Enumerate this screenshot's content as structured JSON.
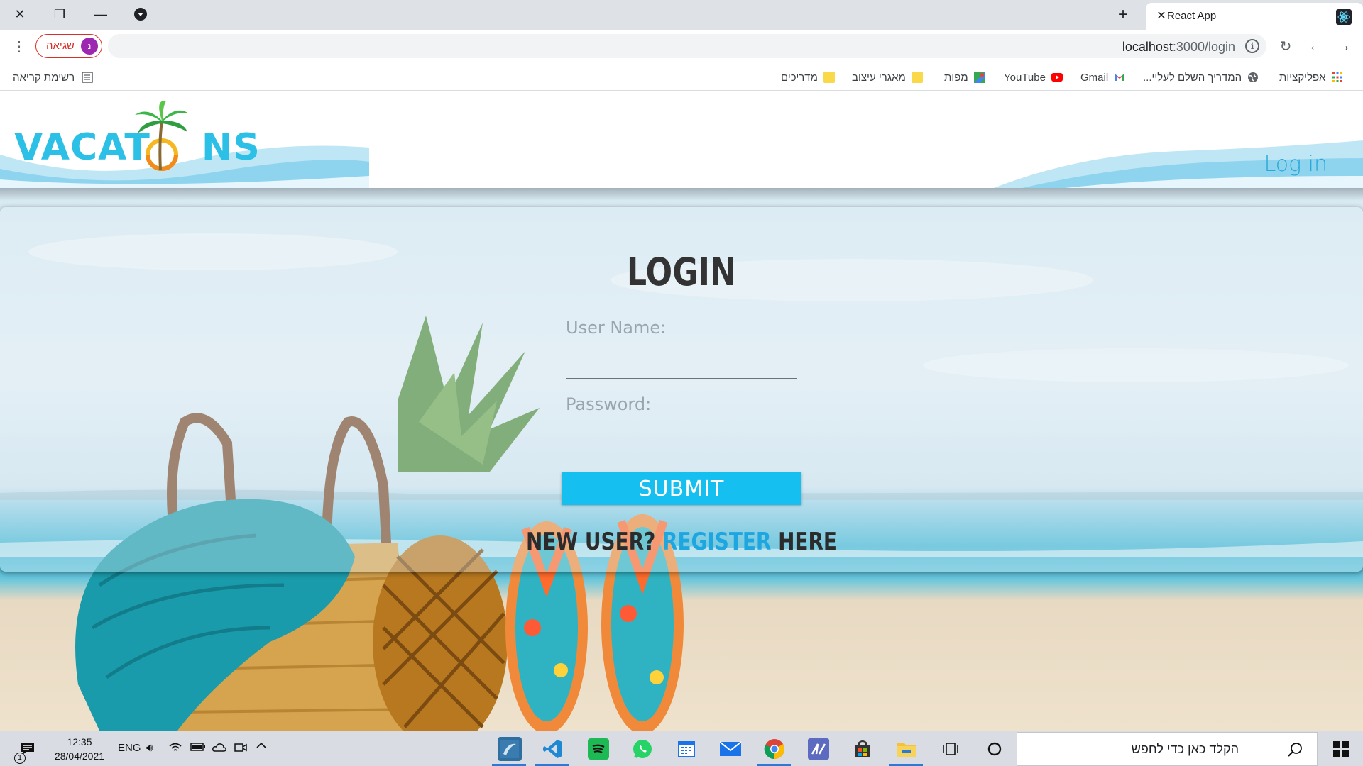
{
  "browser": {
    "tab_title": "React App",
    "url_host": "localhost",
    "url_path": ":3000/login",
    "profile_label": "שגיאה",
    "profile_initial": "נ",
    "bookmarks": [
      {
        "label": "אפליקציות",
        "icon": "apps-grid-icon"
      },
      {
        "label": "...המדריך השלם לעליי",
        "icon": "globe-icon"
      },
      {
        "label": "Gmail",
        "icon": "gmail-icon"
      },
      {
        "label": "YouTube",
        "icon": "youtube-icon"
      },
      {
        "label": "מפות",
        "icon": "maps-icon"
      },
      {
        "label": "מאגרי עיצוב",
        "icon": "folder-icon"
      },
      {
        "label": "מדריכים",
        "icon": "folder-icon"
      }
    ],
    "reading_list": "רשימת קריאה"
  },
  "site": {
    "logo_text_left": "VACAT",
    "logo_text_right": "NS",
    "nav_login": "Log in",
    "accent_color": "#15bff0"
  },
  "login": {
    "title": "LOGIN",
    "username_label": "User Name:",
    "username_value": "",
    "password_label": "Password:",
    "password_value": "",
    "submit_label": "SUBMIT",
    "register_prefix": "NEW USER? ",
    "register_link": "REGISTER",
    "register_suffix": " HERE"
  },
  "taskbar": {
    "time": "12:35",
    "date": "28/04/2021",
    "lang": "ENG",
    "notification_count": "1",
    "search_placeholder": "הקלד כאן כדי לחפש"
  }
}
